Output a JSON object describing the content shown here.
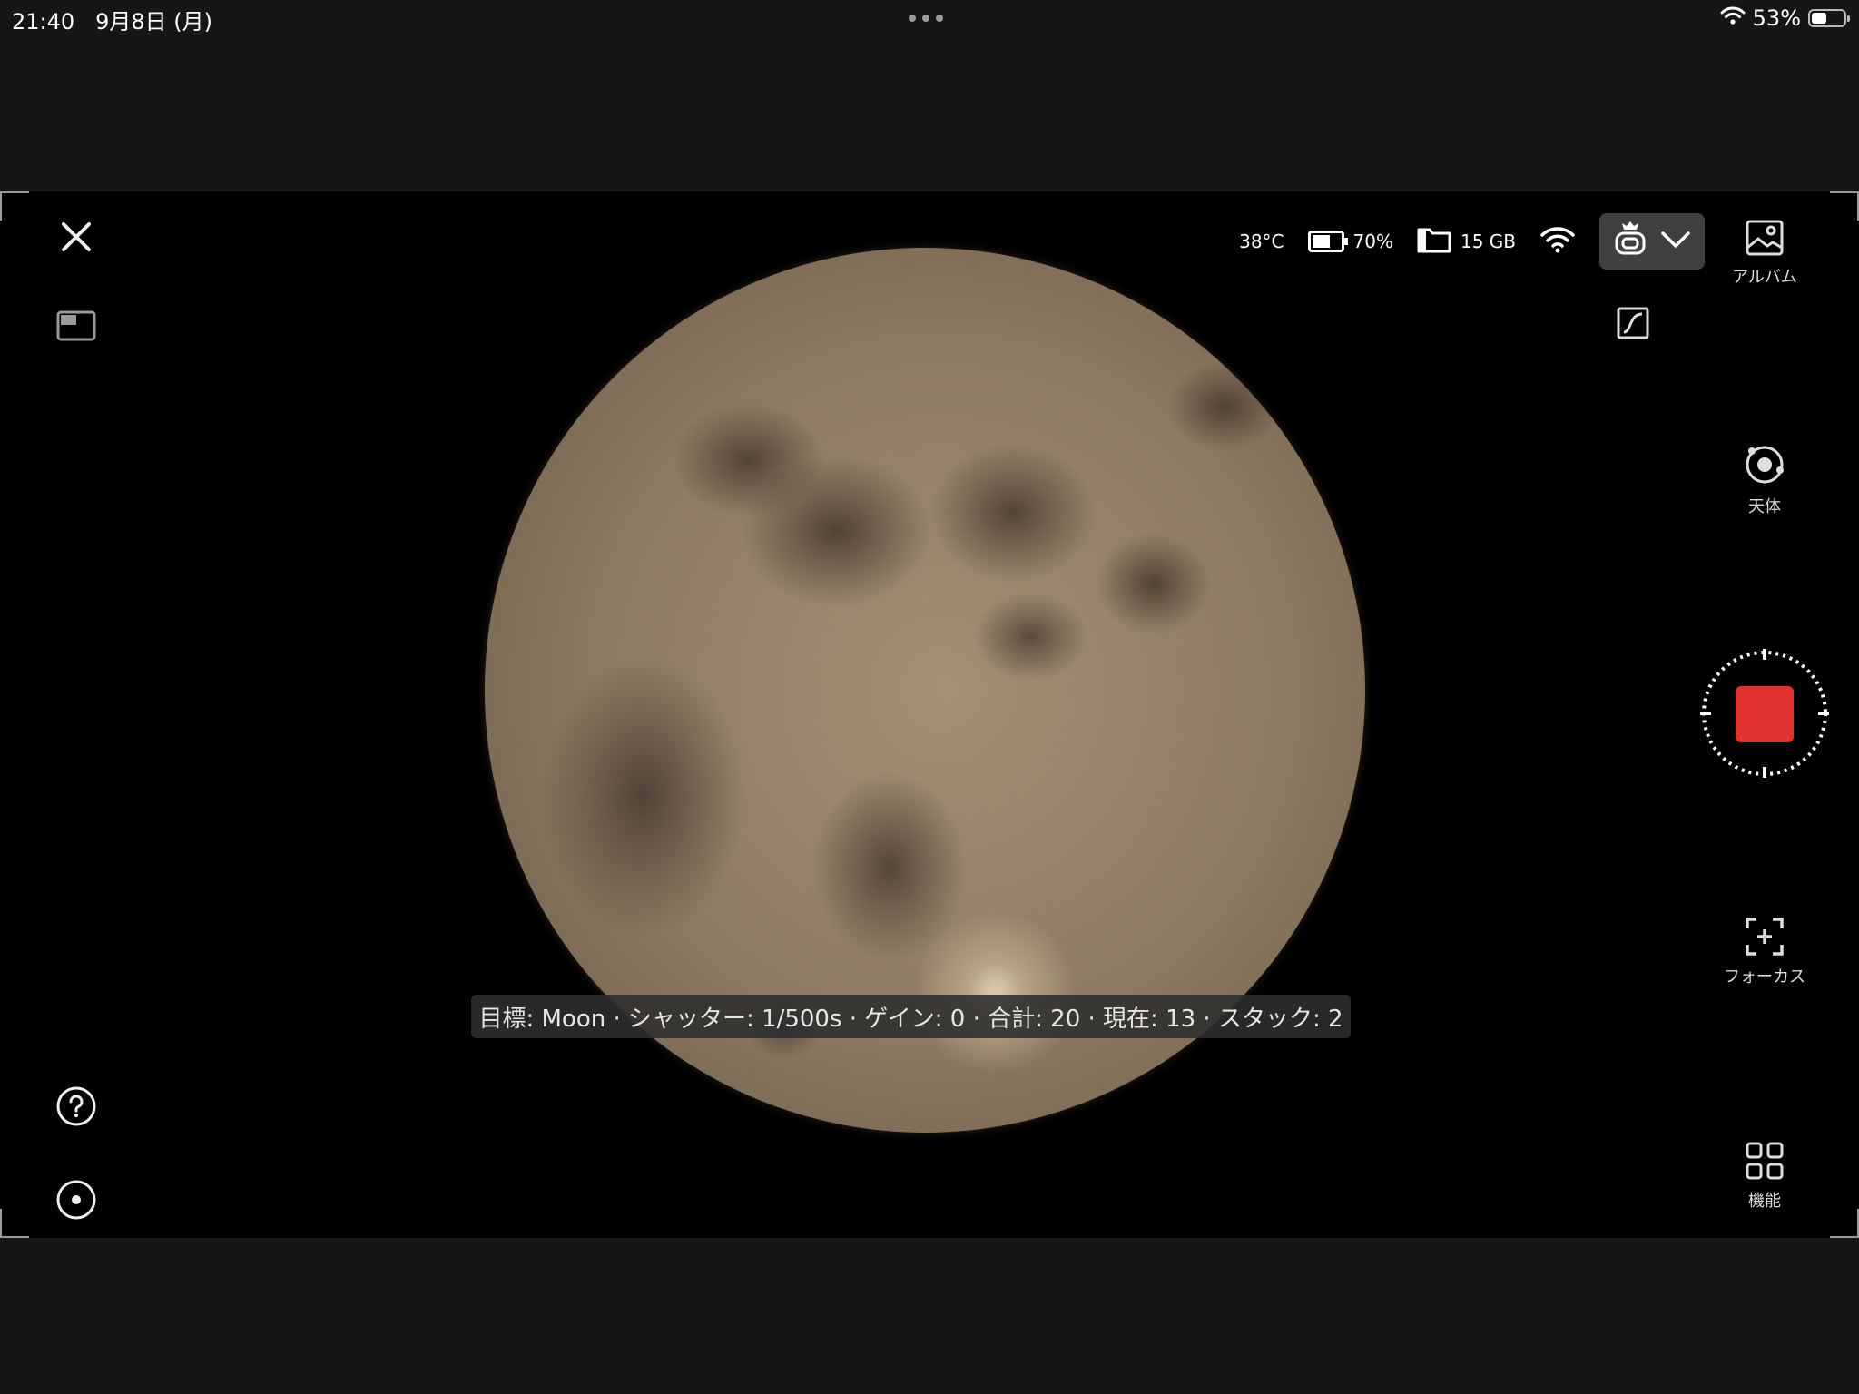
{
  "status_bar": {
    "time": "21:40",
    "date": "9月8日 (月)",
    "battery": "53%",
    "battery_level": 0.53,
    "icons": [
      "wifi-icon",
      "battery-icon",
      "more-dots-icon"
    ]
  },
  "hud": {
    "temperature": "38°C",
    "battery": "70%",
    "battery_level": 0.7,
    "storage": "15 GB",
    "icons": [
      "battery-icon",
      "folder-icon",
      "wifi-icon",
      "telescope-device-icon",
      "chevron-down-icon"
    ]
  },
  "left_toolbar": {
    "icons": [
      "close-icon",
      "picture-in-picture-icon",
      "help-icon",
      "target-icon"
    ]
  },
  "right_panel": {
    "album_label": "アルバム",
    "celestial_label": "天体",
    "focus_label": "フォーカス",
    "functions_label": "機能",
    "icons": [
      "curve-icon",
      "album-icon",
      "celestial-icon",
      "record-stop-icon",
      "focus-icon",
      "grid-icon"
    ]
  },
  "info_bar": {
    "text": "目標: Moon · シャッター: 1/500s · ゲイン: 0 · 合計: 20 · 現在: 13 · スタック: 2"
  },
  "colors": {
    "background": "#161616",
    "viewer": "#000000",
    "record": "#e03030",
    "device_button": "#3f3f3f"
  }
}
